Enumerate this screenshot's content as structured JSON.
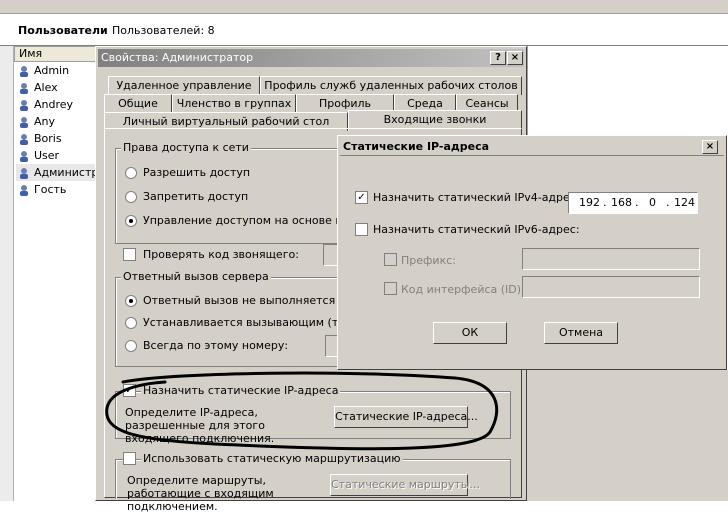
{
  "header": {
    "title": "Пользователи",
    "count_label": "Пользователей: 8"
  },
  "list": {
    "column_name": "Имя",
    "users": [
      "Admin",
      "Alex",
      "Andrey",
      "Any",
      "Boris",
      "User",
      "Администратор",
      "Гость"
    ]
  },
  "props_dialog": {
    "title": "Свойства: Администратор",
    "help_btn": "?",
    "close_btn": "×",
    "tabs_row1": [
      "Удаленное управление",
      "Профиль служб удаленных рабочих столов"
    ],
    "tabs_row2": [
      "Общие",
      "Членство в группах",
      "Профиль",
      "Среда",
      "Сеансы"
    ],
    "tabs_row3": [
      "Личный виртуальный рабочий стол",
      "Входящие звонки"
    ],
    "access": {
      "group_label": "Права доступа к сети",
      "allow": "Разрешить доступ",
      "deny": "Запретить доступ",
      "policy": "Управление доступом на основе полит"
    },
    "verify_caller": "Проверять код звонящего:",
    "callback": {
      "group_label": "Ответный вызов сервера",
      "none": "Ответный вызов не выполняется",
      "by_caller": "Устанавливается вызывающим (тольк",
      "always": "Всегда по этому номеру:"
    },
    "static_ip": {
      "check_label": "Назначить статические IP-адреса",
      "description": "Определите IP-адреса, разрешенные для этого входящего подключения.",
      "button": "Статические IP-адреса..."
    },
    "static_routes": {
      "check_label": "Использовать статическую маршрутизацию",
      "description": "Определите маршруты, работающие с входящим подключением.",
      "button": "Статические маршруты..."
    }
  },
  "ip_dialog": {
    "title": "Статические IP-адреса",
    "close_btn": "×",
    "ipv4_label": "Назначить статический IPv4-адрес:",
    "ipv4": [
      "192",
      "168",
      "0",
      "124"
    ],
    "ipv6_label": "Назначить статический IPv6-адрес:",
    "prefix_label": "Префикс:",
    "iface_label": "Код интерфейса (ID):",
    "ok": "ОК",
    "cancel": "Отмена"
  }
}
